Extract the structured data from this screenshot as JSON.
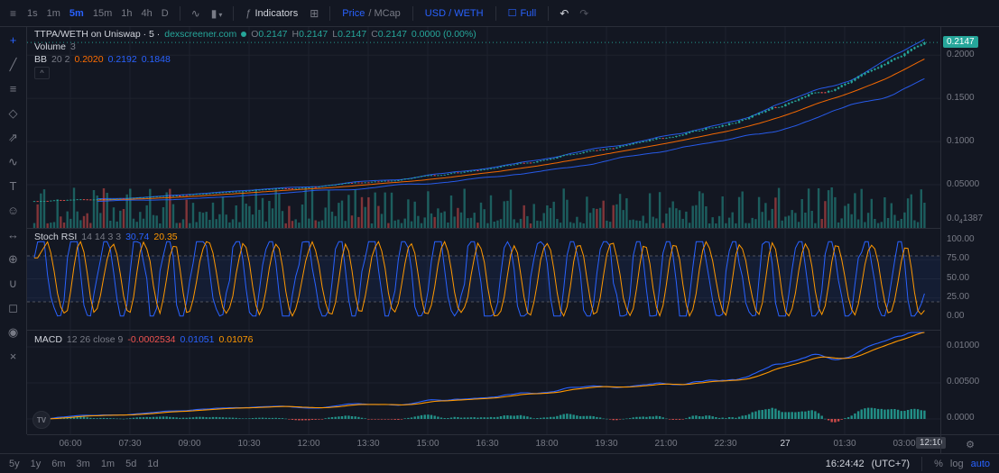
{
  "colors": {
    "bg": "#131722",
    "up": "#26a69a",
    "down": "#ef5350",
    "blue": "#2962ff",
    "orange": "#ff9800",
    "basis": "#ff6d00",
    "text": "#d1d4dc",
    "muted": "#787b86",
    "grid": "#1e222d",
    "border": "#2a2e39",
    "band_fill": "rgba(41,98,255,0.08)"
  },
  "top_toolbar": {
    "menu_icon": "≡",
    "timeframes": [
      "1s",
      "1m",
      "5m",
      "15m",
      "1h",
      "4h",
      "D"
    ],
    "active_timeframe": "5m",
    "line_chart_icon": "∿",
    "candle_chart_icon": "▮",
    "caret_icon": "▾",
    "indicators_icon": "ƒ",
    "indicators_label": "Indicators",
    "layout_icon": "⊞",
    "price_label": "Price",
    "mcap_label": "/ MCap",
    "currency_toggle": "USD / WETH",
    "full_icon": "☐",
    "full_label": "Full",
    "undo_icon": "↶",
    "redo_icon": "↷"
  },
  "left_toolbar": {
    "tools": [
      {
        "name": "crosshair-cursor",
        "glyph": "+"
      },
      {
        "name": "trend-line",
        "glyph": "╱"
      },
      {
        "name": "fib-retracement",
        "glyph": "≡"
      },
      {
        "name": "xabcd-pattern",
        "glyph": "◇"
      },
      {
        "name": "forecast",
        "glyph": "⇗"
      },
      {
        "name": "brush",
        "glyph": "∿"
      },
      {
        "name": "text-tool",
        "glyph": "T"
      },
      {
        "name": "emoji",
        "glyph": "☺"
      },
      {
        "name": "measure",
        "glyph": "↔"
      },
      {
        "name": "zoom-in",
        "glyph": "⊕"
      },
      {
        "name": "magnet",
        "glyph": "∪"
      },
      {
        "name": "lock-drawings",
        "glyph": "◻"
      },
      {
        "name": "hide-drawings",
        "glyph": "◉"
      },
      {
        "name": "delete-drawings",
        "glyph": "×"
      }
    ]
  },
  "legend": {
    "symbol_interval": "TTPA/WETH on Uniswap · 5 ·",
    "source": "dexscreener.com",
    "o_label": "O",
    "o": "0.2147",
    "h_label": "H",
    "h": "0.2147",
    "l_label": "L",
    "l": "0.2147",
    "c_label": "C",
    "c": "0.2147",
    "change": "0.0000 (0.00%)",
    "volume_label": "Volume",
    "volume_value": "3",
    "bb_label": "BB",
    "bb_params": "20 2",
    "bb_basis": "0.2020",
    "bb_upper": "0.2192",
    "bb_lower": "0.1848",
    "collapse_icon": "^"
  },
  "stoch_legend": {
    "label": "Stoch RSI",
    "params": "14 14 3 3",
    "k": "30.74",
    "d": "20.35"
  },
  "macd_legend": {
    "label": "MACD",
    "params": "12 26 close 9",
    "hist": "-0.0002534",
    "macd": "0.01051",
    "signal": "0.01076"
  },
  "price_axis": {
    "last_badge": "0.2147",
    "labels": [
      {
        "text": "0.2000",
        "value": 0.2
      },
      {
        "text": "0.1500",
        "value": 0.15
      },
      {
        "text": "0.1000",
        "value": 0.1
      },
      {
        "text": "0.05000",
        "value": 0.05
      }
    ],
    "bottom_label": {
      "prefix": "0.0",
      "sub": "4",
      "digits": "1387"
    }
  },
  "stoch_axis": [
    {
      "text": "100.00",
      "value": 100
    },
    {
      "text": "75.00",
      "value": 75
    },
    {
      "text": "50.00",
      "value": 50
    },
    {
      "text": "25.00",
      "value": 25
    },
    {
      "text": "0.00",
      "value": 0
    }
  ],
  "macd_axis": [
    {
      "text": "0.01000",
      "value": 0.01
    },
    {
      "text": "0.00500",
      "value": 0.005
    },
    {
      "text": "0.0000",
      "value": 0
    }
  ],
  "time_axis": {
    "labels": [
      "06:00",
      "07:30",
      "09:00",
      "10:30",
      "12:00",
      "13:30",
      "15:00",
      "16:30",
      "18:00",
      "19:30",
      "21:00",
      "22:30",
      "27",
      "01:30",
      "03:00"
    ],
    "bright": "27",
    "end_badge": "12:10"
  },
  "footer": {
    "ranges": [
      "5y",
      "1y",
      "6m",
      "3m",
      "1m",
      "5d",
      "1d"
    ],
    "clock": "16:24:42",
    "timezone": "(UTC+7)",
    "percent_label": "%",
    "log_label": "log",
    "auto_label": "auto",
    "gear_icon": "⚙"
  },
  "watermark": "TV",
  "chart_data": {
    "type": "candlestick",
    "pair": "TTPA/WETH",
    "venue": "Uniswap",
    "interval_minutes": 5,
    "visible_bars": 270,
    "price_ylim": [
      0,
      0.2325
    ],
    "price_gridlines": [
      0.05,
      0.1,
      0.15,
      0.2
    ],
    "price_anchors_t": [
      0,
      0.08,
      0.16,
      0.24,
      0.32,
      0.4,
      0.48,
      0.56,
      0.64,
      0.72,
      0.8,
      0.86,
      0.92,
      0.96,
      1
    ],
    "price_anchors_v": [
      0.031,
      0.034,
      0.038,
      0.043,
      0.049,
      0.056,
      0.065,
      0.076,
      0.09,
      0.107,
      0.128,
      0.147,
      0.17,
      0.192,
      0.2147
    ],
    "last_close": 0.2147,
    "ohlc_last": {
      "open": 0.2147,
      "high": 0.2147,
      "low": 0.2147,
      "close": 0.2147,
      "change": 0,
      "change_pct": 0
    },
    "volume_last": 3,
    "bollinger": {
      "length": 20,
      "mult": 2,
      "basis_last": 0.202,
      "upper_last": 0.2192,
      "lower_last": 0.1848
    },
    "stoch_rsi": {
      "k_period": 14,
      "d_period": 14,
      "smooth_k": 3,
      "smooth_d": 3,
      "k_last": 30.74,
      "d_last": 20.35,
      "ylim": [
        0,
        100
      ],
      "bands": [
        20,
        80
      ],
      "cycle_bars": 10
    },
    "macd": {
      "fast": 12,
      "slow": 26,
      "source": "close",
      "signal": 9,
      "hist_last": -0.0002534,
      "macd_last": 0.01051,
      "signal_last": 0.01076,
      "ylim": [
        -0.0016,
        0.0125
      ]
    }
  }
}
